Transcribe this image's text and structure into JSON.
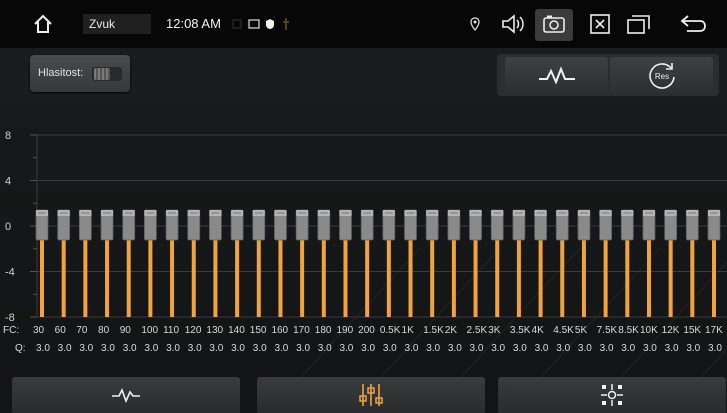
{
  "statusbar": {
    "app_title": "Zvuk",
    "clock": "12:08 AM"
  },
  "controls": {
    "loudness_label": "Hlasitost:",
    "reset_badge": "Res"
  },
  "chart_data": {
    "type": "bar",
    "y_axis_ticks": [
      "8",
      "4",
      "0",
      "-4",
      "-8"
    ],
    "ylim": [
      -8,
      8
    ],
    "fc_label": "FC:",
    "q_label": "Q:",
    "categories": [
      "30",
      "60",
      "70",
      "80",
      "90",
      "100",
      "110",
      "120",
      "130",
      "140",
      "150",
      "160",
      "170",
      "180",
      "190",
      "200",
      "0.5K",
      "1K",
      "1.5K",
      "2K",
      "2.5K",
      "3K",
      "3.5K",
      "4K",
      "4.5K",
      "5K",
      "7.5K",
      "8.5K",
      "10K",
      "12K",
      "15K",
      "17K"
    ],
    "q_values": [
      "3.0",
      "3.0",
      "3.0",
      "3.0",
      "3.0",
      "3.0",
      "3.0",
      "3.0",
      "3.0",
      "3.0",
      "3.0",
      "3.0",
      "3.0",
      "3.0",
      "3.0",
      "3.0",
      "3.0",
      "3.0",
      "3.0",
      "3.0",
      "3.0",
      "3.0",
      "3.0",
      "3.0",
      "3.0",
      "3.0",
      "3.0",
      "3.0",
      "3.0",
      "3.0",
      "3.0",
      "3.0"
    ],
    "values": [
      0,
      0,
      0,
      0,
      0,
      0,
      0,
      0,
      0,
      0,
      0,
      0,
      0,
      0,
      0,
      0,
      0,
      0,
      0,
      0,
      0,
      0,
      0,
      0,
      0,
      0,
      0,
      0,
      0,
      0,
      0,
      0
    ],
    "colors": {
      "track": "#f0a43a",
      "knob": "#8a8a8a",
      "grid": "#3a3b3c"
    }
  }
}
